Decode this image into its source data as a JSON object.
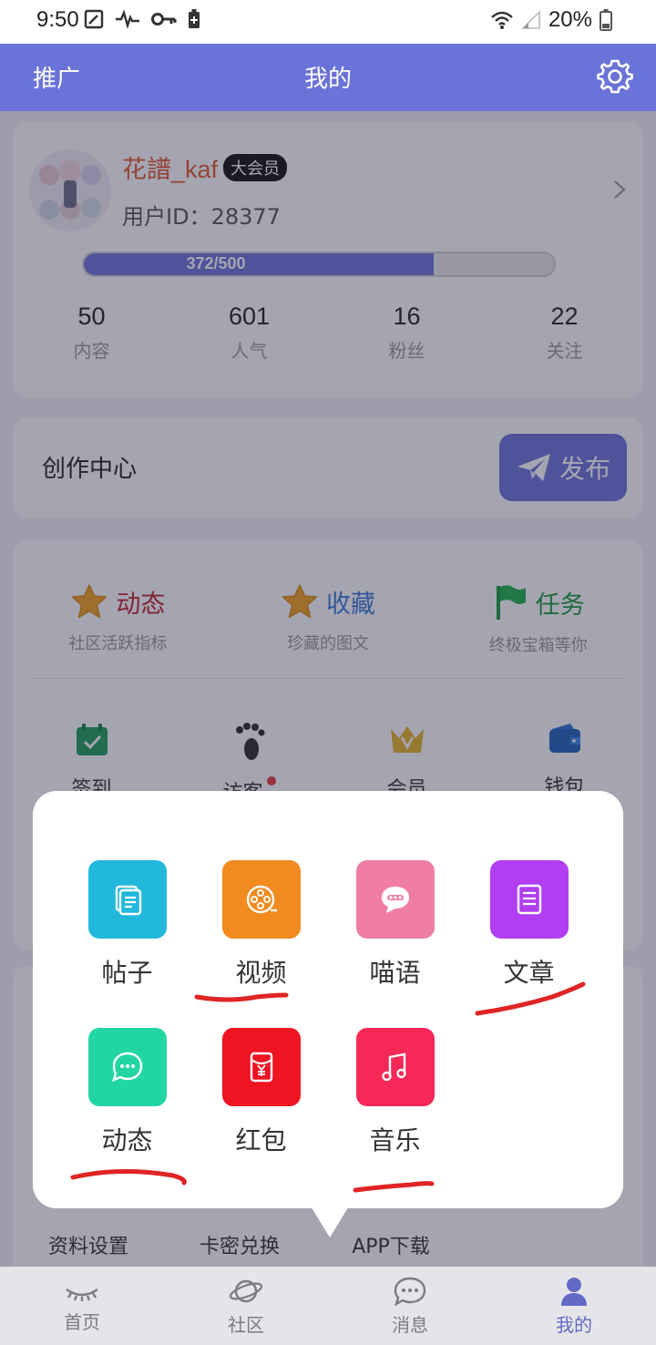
{
  "status_bar": {
    "time": "9:50",
    "battery": "20%"
  },
  "header": {
    "left_label": "推广",
    "title": "我的",
    "settings_icon": "gear-icon",
    "color": "#6a73d8"
  },
  "profile": {
    "username": "花譜_kaf",
    "badge": "大会员",
    "user_id_label": "用户ID：",
    "user_id": "28377",
    "level_text": "372/500",
    "level_progress": 0.744,
    "stats": [
      {
        "value": "50",
        "label": "内容"
      },
      {
        "value": "601",
        "label": "人气"
      },
      {
        "value": "16",
        "label": "粉丝"
      },
      {
        "value": "22",
        "label": "关注"
      }
    ]
  },
  "creator": {
    "title": "创作中心",
    "publish_label": "发布"
  },
  "features": {
    "top": [
      {
        "title": "动态",
        "subtitle": "社区活跃指标",
        "title_color": "#c0232c",
        "icon": "star-icon"
      },
      {
        "title": "收藏",
        "subtitle": "珍藏的图文",
        "title_color": "#3a7bd5",
        "icon": "star-icon"
      },
      {
        "title": "任务",
        "subtitle": "终极宝箱等你",
        "title_color": "#1a9a3a",
        "icon": "flag-icon"
      }
    ],
    "grid": [
      {
        "label": "签到",
        "icon": "calendar-check-icon"
      },
      {
        "label": "访客",
        "icon": "footprint-icon"
      },
      {
        "label": "会员",
        "icon": "vip-crown-icon"
      },
      {
        "label": "钱包",
        "icon": "wallet-icon"
      }
    ]
  },
  "settings": {
    "items": [
      "资料设置",
      "卡密兑换",
      "APP下载"
    ]
  },
  "bottom_nav": [
    {
      "label": "首页",
      "icon": "eye-icon",
      "active": false
    },
    {
      "label": "社区",
      "icon": "planet-icon",
      "active": false
    },
    {
      "label": "消息",
      "icon": "chat-bubble-icon",
      "active": false
    },
    {
      "label": "我的",
      "icon": "user-icon",
      "active": true
    }
  ],
  "publish_menu": {
    "items": [
      {
        "label": "帖子",
        "color": "#22b8dc",
        "icon": "document-icon"
      },
      {
        "label": "视频",
        "color": "#f18a1f",
        "icon": "film-reel-icon"
      },
      {
        "label": "喵语",
        "color": "#f07ea3",
        "icon": "chat-icon"
      },
      {
        "label": "文章",
        "color": "#b13ef0",
        "icon": "article-icon"
      },
      {
        "label": "动态",
        "color": "#22d6a4",
        "icon": "speech-bubble-icon"
      },
      {
        "label": "红包",
        "color": "#ee1422",
        "icon": "red-envelope-icon"
      },
      {
        "label": "音乐",
        "color": "#f62858",
        "icon": "music-note-icon"
      }
    ]
  }
}
